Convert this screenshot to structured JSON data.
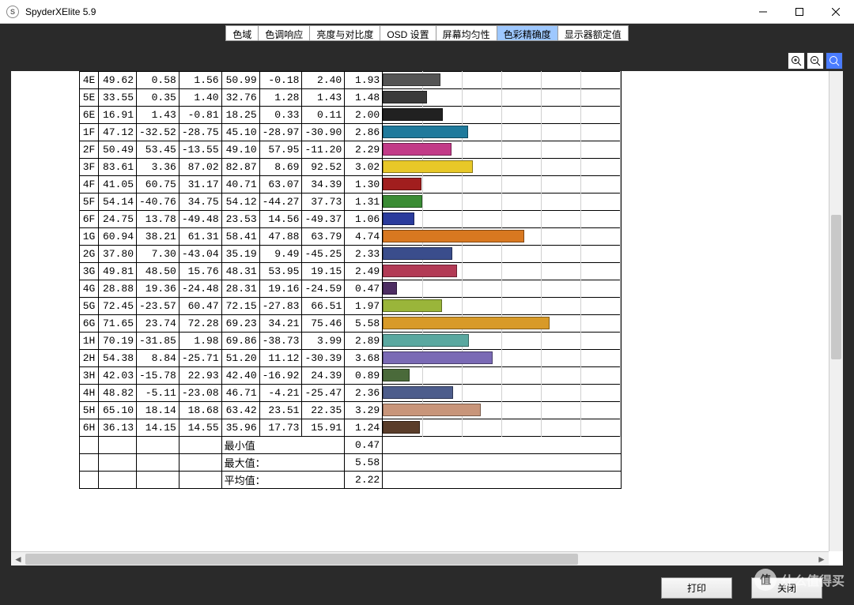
{
  "window": {
    "title": "SpyderXElite 5.9",
    "icon_letter": "S"
  },
  "tabs": [
    {
      "label": "色域"
    },
    {
      "label": "色调响应"
    },
    {
      "label": "亮度与对比度"
    },
    {
      "label": "OSD 设置"
    },
    {
      "label": "屏幕均匀性"
    },
    {
      "label": "色彩精确度",
      "active": true
    },
    {
      "label": "显示器额定值"
    }
  ],
  "footer": {
    "print": "打印",
    "close": "关闭"
  },
  "stats": {
    "min_label": "最小值",
    "min_value": "0.47",
    "max_label": "最大值：",
    "max_value": "5.58",
    "avg_label": "平均值：",
    "avg_value": "2.22"
  },
  "chart_data": {
    "type": "bar",
    "max_de": 5.58,
    "grid_step": 50,
    "rows": [
      {
        "id": "4E",
        "a1": "49.62",
        "a2": "0.58",
        "a3": "1.56",
        "b1": "50.99",
        "b2": "-0.18",
        "b3": "2.40",
        "de": 1.93,
        "color": "#545454"
      },
      {
        "id": "5E",
        "a1": "33.55",
        "a2": "0.35",
        "a3": "1.40",
        "b1": "32.76",
        "b2": "1.28",
        "b3": "1.43",
        "de": 1.48,
        "color": "#3a3a3a"
      },
      {
        "id": "6E",
        "a1": "16.91",
        "a2": "1.43",
        "a3": "-0.81",
        "b1": "18.25",
        "b2": "0.33",
        "b3": "0.11",
        "de": 2.0,
        "color": "#212121"
      },
      {
        "id": "1F",
        "a1": "47.12",
        "a2": "-32.52",
        "a3": "-28.75",
        "b1": "45.10",
        "b2": "-28.97",
        "b3": "-30.90",
        "de": 2.86,
        "color": "#1f7a9c"
      },
      {
        "id": "2F",
        "a1": "50.49",
        "a2": "53.45",
        "a3": "-13.55",
        "b1": "49.10",
        "b2": "57.95",
        "b3": "-11.20",
        "de": 2.29,
        "color": "#c23a88"
      },
      {
        "id": "3F",
        "a1": "83.61",
        "a2": "3.36",
        "a3": "87.02",
        "b1": "82.87",
        "b2": "8.69",
        "b3": "92.52",
        "de": 3.02,
        "color": "#e8c828"
      },
      {
        "id": "4F",
        "a1": "41.05",
        "a2": "60.75",
        "a3": "31.17",
        "b1": "40.71",
        "b2": "63.07",
        "b3": "34.39",
        "de": 1.3,
        "color": "#a11e1e"
      },
      {
        "id": "5F",
        "a1": "54.14",
        "a2": "-40.76",
        "a3": "34.75",
        "b1": "54.12",
        "b2": "-44.27",
        "b3": "37.73",
        "de": 1.31,
        "color": "#3a8c34"
      },
      {
        "id": "6F",
        "a1": "24.75",
        "a2": "13.78",
        "a3": "-49.48",
        "b1": "23.53",
        "b2": "14.56",
        "b3": "-49.37",
        "de": 1.06,
        "color": "#2a3b9c"
      },
      {
        "id": "1G",
        "a1": "60.94",
        "a2": "38.21",
        "a3": "61.31",
        "b1": "58.41",
        "b2": "47.88",
        "b3": "63.79",
        "de": 4.74,
        "color": "#d87820"
      },
      {
        "id": "2G",
        "a1": "37.80",
        "a2": "7.30",
        "a3": "-43.04",
        "b1": "35.19",
        "b2": "9.49",
        "b3": "-45.25",
        "de": 2.33,
        "color": "#3a4d8c"
      },
      {
        "id": "3G",
        "a1": "49.81",
        "a2": "48.50",
        "a3": "15.76",
        "b1": "48.31",
        "b2": "53.95",
        "b3": "19.15",
        "de": 2.49,
        "color": "#b23a55"
      },
      {
        "id": "4G",
        "a1": "28.88",
        "a2": "19.36",
        "a3": "-24.48",
        "b1": "28.31",
        "b2": "19.16",
        "b3": "-24.59",
        "de": 0.47,
        "color": "#4d2d62"
      },
      {
        "id": "5G",
        "a1": "72.45",
        "a2": "-23.57",
        "a3": "60.47",
        "b1": "72.15",
        "b2": "-27.83",
        "b3": "66.51",
        "de": 1.97,
        "color": "#9ab53a"
      },
      {
        "id": "6G",
        "a1": "71.65",
        "a2": "23.74",
        "a3": "72.28",
        "b1": "69.23",
        "b2": "34.21",
        "b3": "75.46",
        "de": 5.58,
        "color": "#d89a28"
      },
      {
        "id": "1H",
        "a1": "70.19",
        "a2": "-31.85",
        "a3": "1.98",
        "b1": "69.86",
        "b2": "-38.73",
        "b3": "3.99",
        "de": 2.89,
        "color": "#5aa8a0"
      },
      {
        "id": "2H",
        "a1": "54.38",
        "a2": "8.84",
        "a3": "-25.71",
        "b1": "51.20",
        "b2": "11.12",
        "b3": "-30.39",
        "de": 3.68,
        "color": "#7a6ab5"
      },
      {
        "id": "3H",
        "a1": "42.03",
        "a2": "-15.78",
        "a3": "22.93",
        "b1": "42.40",
        "b2": "-16.92",
        "b3": "24.39",
        "de": 0.89,
        "color": "#4a6a3a"
      },
      {
        "id": "4H",
        "a1": "48.82",
        "a2": "-5.11",
        "a3": "-23.08",
        "b1": "46.71",
        "b2": "-4.21",
        "b3": "-25.47",
        "de": 2.36,
        "color": "#4d5d8c"
      },
      {
        "id": "5H",
        "a1": "65.10",
        "a2": "18.14",
        "a3": "18.68",
        "b1": "63.42",
        "b2": "23.51",
        "b3": "22.35",
        "de": 3.29,
        "color": "#c8957a"
      },
      {
        "id": "6H",
        "a1": "36.13",
        "a2": "14.15",
        "a3": "14.55",
        "b1": "35.96",
        "b2": "17.73",
        "b3": "15.91",
        "de": 1.24,
        "color": "#5a3d2a"
      }
    ]
  },
  "watermark": {
    "circle": "值",
    "text": "什么值得买"
  }
}
